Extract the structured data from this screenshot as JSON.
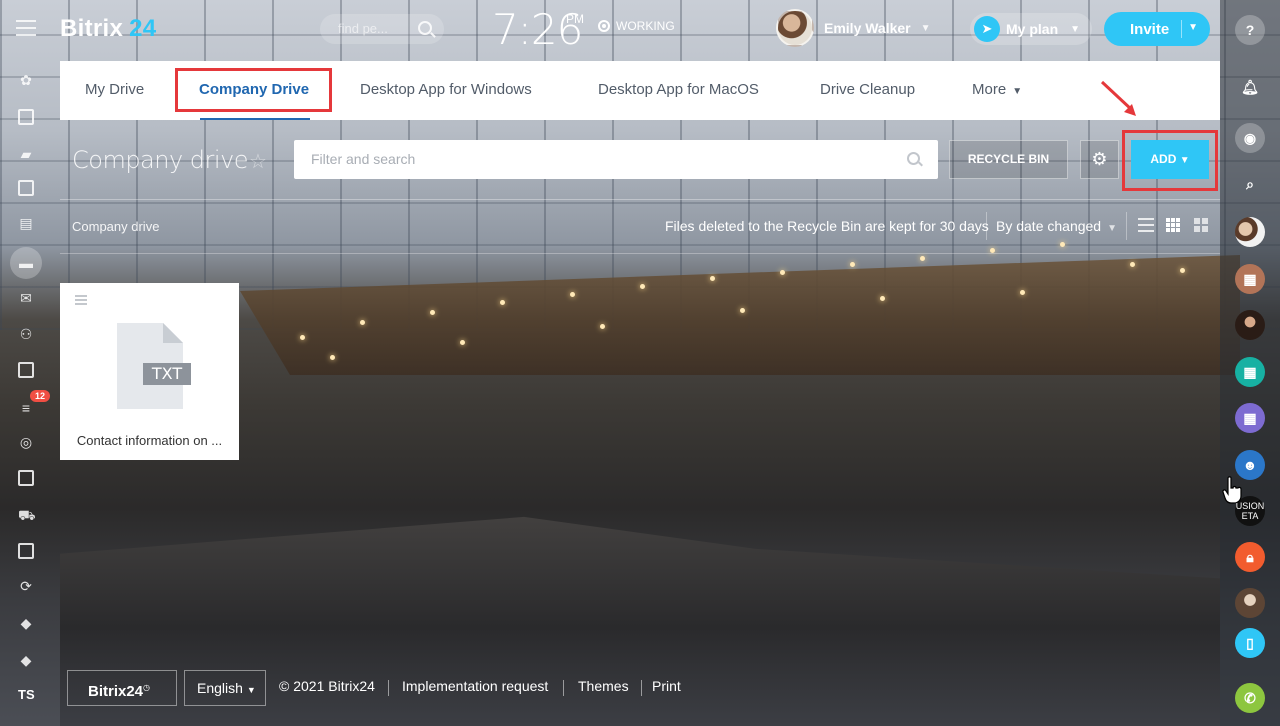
{
  "header": {
    "logo_text": "Bitrix",
    "logo_num": "24",
    "search_placeholder": "find pe...",
    "time": "7:26",
    "time_suffix": "PM",
    "status": "WORKING",
    "user_name": "Emily Walker",
    "my_plan_label": "My plan",
    "invite_label": "Invite"
  },
  "tabs": [
    {
      "label": "My Drive"
    },
    {
      "label": "Company Drive"
    },
    {
      "label": "Desktop App for Windows"
    },
    {
      "label": "Desktop App for MacOS"
    },
    {
      "label": "Drive Cleanup"
    },
    {
      "label": "More"
    }
  ],
  "toolbar": {
    "title": "Company drive",
    "filter_placeholder": "Filter and search",
    "recycle_label": "RECYCLE BIN",
    "add_label": "ADD"
  },
  "subbar": {
    "breadcrumb": "Company drive",
    "note": "Files deleted to the Recycle Bin are kept for 30 days",
    "sort_label": "By date changed"
  },
  "files": [
    {
      "name": "Contact information on ...",
      "ext": "TXT"
    }
  ],
  "left_sidebar": {
    "badge_count": "12",
    "initials": "TS"
  },
  "right_sidebar": {
    "items": [
      {
        "icon": "help-icon",
        "glyph": "?"
      },
      {
        "icon": "bell-icon",
        "glyph": ""
      },
      {
        "icon": "chat-icon",
        "glyph": ""
      },
      {
        "icon": "search-icon",
        "glyph": ""
      },
      {
        "icon": "group-avatar-icon",
        "glyph": ""
      },
      {
        "icon": "calendar-icon",
        "glyph": ""
      },
      {
        "icon": "user-avatar-icon",
        "glyph": ""
      },
      {
        "icon": "calendar-green-icon",
        "glyph": ""
      },
      {
        "icon": "calendar-purple-icon",
        "glyph": ""
      },
      {
        "icon": "openline-chat-icon",
        "glyph": ""
      },
      {
        "icon": "fusion-logo-icon",
        "glyph": ""
      },
      {
        "icon": "lock-icon",
        "glyph": ""
      },
      {
        "icon": "user-avatar-2-icon",
        "glyph": ""
      },
      {
        "icon": "mobile-transfer-icon",
        "glyph": ""
      },
      {
        "icon": "phone-icon",
        "glyph": ""
      }
    ],
    "fusion_text_1": "USION",
    "fusion_text_2": "ETA"
  },
  "footer": {
    "logo_text": "Bitrix24",
    "language": "English",
    "copyright": "© 2021 Bitrix24",
    "links": [
      "Implementation request",
      "Themes",
      "Print"
    ]
  },
  "colors": {
    "accent": "#2fc6f6",
    "tab_active": "#2067b0",
    "highlight_red": "#e5383b",
    "badge_red": "#f04e43"
  }
}
